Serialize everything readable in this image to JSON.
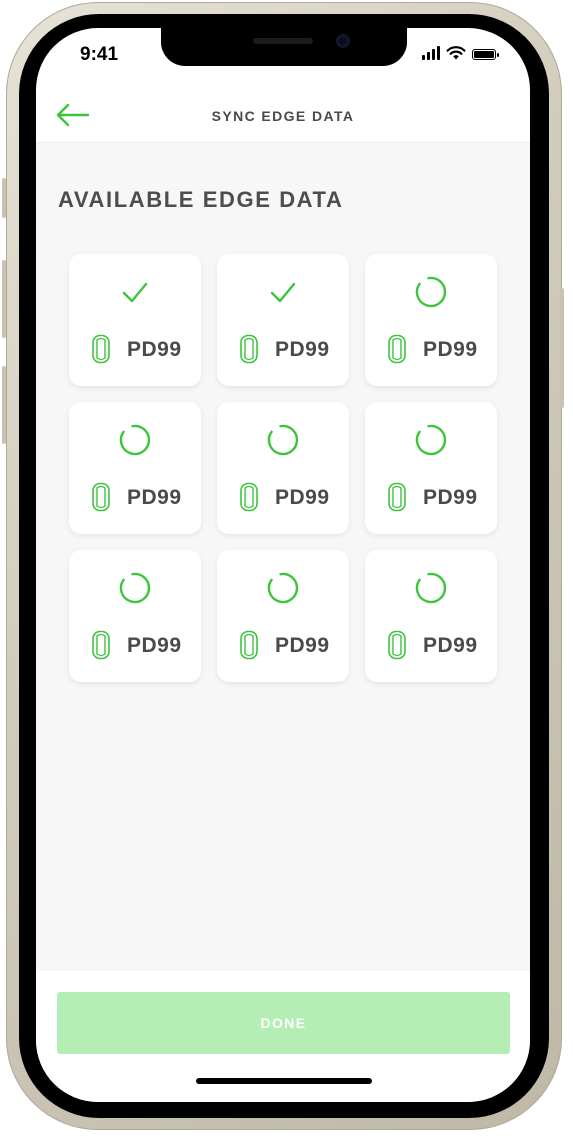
{
  "status_bar": {
    "time": "9:41"
  },
  "header": {
    "title": "SYNC EDGE DATA",
    "back_icon": "arrow-left-icon"
  },
  "section": {
    "title": "AVAILABLE EDGE DATA"
  },
  "colors": {
    "accent": "#3dc43d",
    "button_disabled": "#b4eeb4",
    "text": "#4a4a4a",
    "background": "#f7f7f7"
  },
  "devices": [
    {
      "label": "PD99",
      "status": "synced",
      "status_icon": "checkmark-icon",
      "device_icon": "device-pod-icon"
    },
    {
      "label": "PD99",
      "status": "synced",
      "status_icon": "checkmark-icon",
      "device_icon": "device-pod-icon"
    },
    {
      "label": "PD99",
      "status": "syncing",
      "status_icon": "loading-spinner-icon",
      "device_icon": "device-pod-icon"
    },
    {
      "label": "PD99",
      "status": "syncing",
      "status_icon": "loading-spinner-icon",
      "device_icon": "device-pod-icon"
    },
    {
      "label": "PD99",
      "status": "syncing",
      "status_icon": "loading-spinner-icon",
      "device_icon": "device-pod-icon"
    },
    {
      "label": "PD99",
      "status": "syncing",
      "status_icon": "loading-spinner-icon",
      "device_icon": "device-pod-icon"
    },
    {
      "label": "PD99",
      "status": "syncing",
      "status_icon": "loading-spinner-icon",
      "device_icon": "device-pod-icon"
    },
    {
      "label": "PD99",
      "status": "syncing",
      "status_icon": "loading-spinner-icon",
      "device_icon": "device-pod-icon"
    },
    {
      "label": "PD99",
      "status": "syncing",
      "status_icon": "loading-spinner-icon",
      "device_icon": "device-pod-icon"
    }
  ],
  "footer": {
    "done_label": "DONE"
  }
}
